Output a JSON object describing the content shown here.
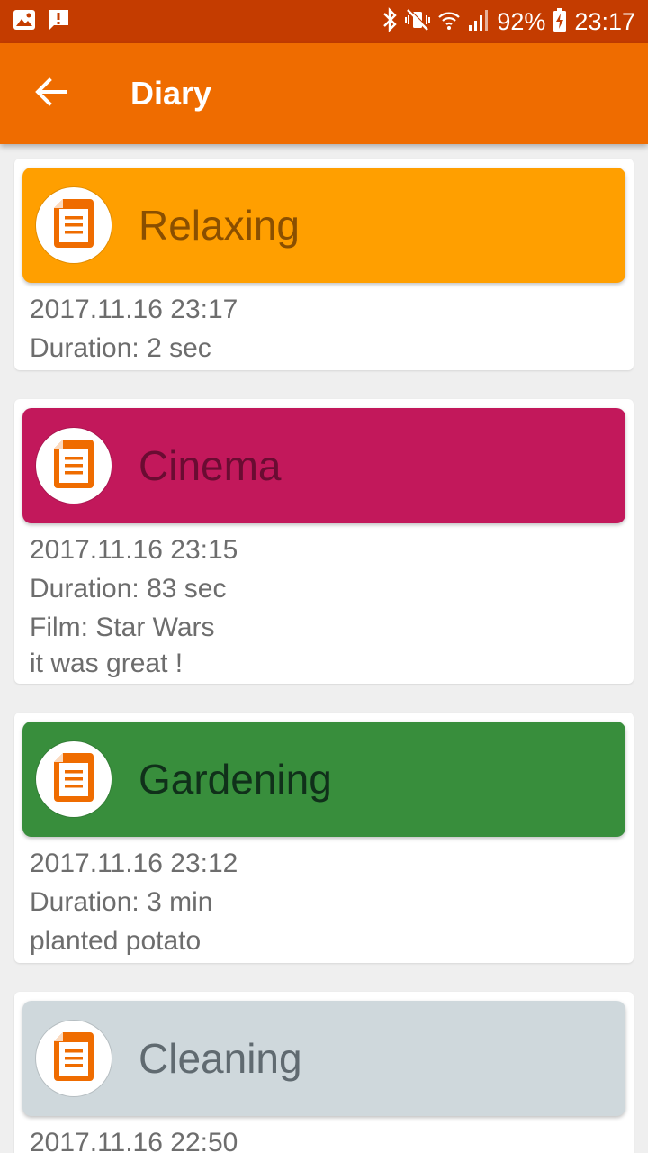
{
  "status_bar": {
    "battery": "92%",
    "time": "23:17",
    "icons": [
      "image-icon",
      "alert-icon",
      "bluetooth-icon",
      "vibrate-mute-icon",
      "wifi-icon",
      "signal-icon",
      "battery-icon"
    ]
  },
  "app_bar": {
    "title": "Diary",
    "back_icon": "arrow-left-icon"
  },
  "colors": {
    "status_bar": "#c43c00",
    "app_bar": "#ef6c00",
    "relaxing": "#ff9f00",
    "cinema": "#c2185b",
    "gardening": "#388e3c",
    "cleaning": "#cfd8dc",
    "doc_icon": "#ef6c00"
  },
  "entries": [
    {
      "title": "Relaxing",
      "icon": "document-icon",
      "datetime": "2017.11.16 23:17",
      "duration": "Duration: 2 sec"
    },
    {
      "title": "Cinema",
      "icon": "document-icon",
      "datetime": "2017.11.16 23:15",
      "duration": "Duration: 83 sec",
      "film": "Film: Star Wars",
      "note": "it was great !"
    },
    {
      "title": "Gardening",
      "icon": "document-icon",
      "datetime": "2017.11.16 23:12",
      "duration": "Duration: 3 min",
      "note": "planted potato"
    },
    {
      "title": "Cleaning",
      "icon": "document-icon",
      "datetime": "2017.11.16 22:50"
    }
  ]
}
